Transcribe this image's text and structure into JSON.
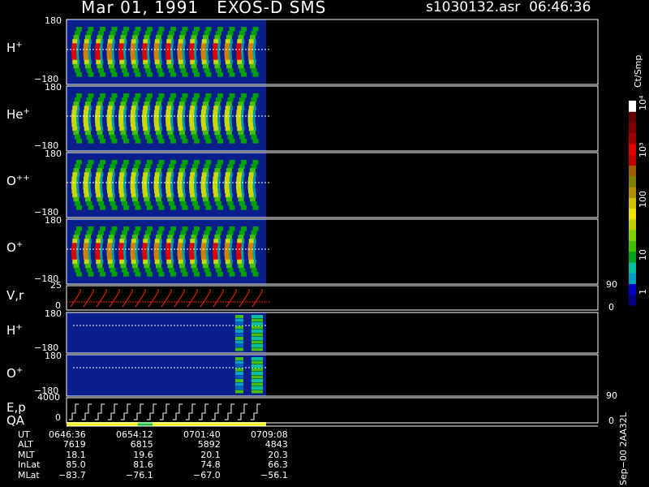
{
  "header": {
    "title": "Mar 01, 1991   EXOS-D SMS",
    "file": "s1030132.asr",
    "time": "06:46:36"
  },
  "panels": [
    {
      "id": "h-plus",
      "species": "H",
      "charge": "+",
      "ymax": "180",
      "ymin": "−180"
    },
    {
      "id": "he-plus",
      "species": "He",
      "charge": "+",
      "ymax": "180",
      "ymin": "−180"
    },
    {
      "id": "o-plus-plus",
      "species": "O",
      "charge": "++",
      "ymax": "180",
      "ymin": "−180"
    },
    {
      "id": "o-plus",
      "species": "O",
      "charge": "+",
      "ymax": "180",
      "ymin": "−180"
    }
  ],
  "vr_panel": {
    "label": "V,r",
    "ymax": "25",
    "ymin": "0",
    "right_top": "90",
    "right_bottom": "0"
  },
  "small_panels": [
    {
      "id": "h-plus-small",
      "species": "H",
      "charge": "+",
      "ymax": "180",
      "ymin": "−180"
    },
    {
      "id": "o-plus-small",
      "species": "O",
      "charge": "+",
      "ymax": "180",
      "ymin": "−180"
    }
  ],
  "ep_panel": {
    "label1": "E,p",
    "label2": "QA",
    "ymax": "4000",
    "ymin": "0",
    "right_top": "90",
    "right_bottom": "0"
  },
  "colorbar": {
    "units": "Ct/Smp",
    "ticks": [
      "1",
      "10",
      "100",
      "10³",
      "10⁴"
    ],
    "colors": [
      "#000080",
      "#0000c0",
      "#00a0c0",
      "#00c0a0",
      "#00a020",
      "#40c000",
      "#80d000",
      "#c0d000",
      "#f0e000",
      "#d0c000",
      "#b09000",
      "#808000",
      "#a06000",
      "#c00000",
      "#e00000",
      "#a00000",
      "#800000",
      "#600000",
      "#ffffff"
    ]
  },
  "footer": {
    "rows": [
      {
        "label": "UT",
        "values": [
          "0646:36",
          "0654:12",
          "0701:40",
          "0709:08"
        ]
      },
      {
        "label": "ALT",
        "values": [
          "7619",
          "6815",
          "5892",
          "4843"
        ]
      },
      {
        "label": "MLT",
        "values": [
          "18.1",
          "19.6",
          "20.1",
          "20.3"
        ]
      },
      {
        "label": "InLat",
        "values": [
          "85.0",
          "81.6",
          "74.8",
          "66.3"
        ]
      },
      {
        "label": "MLat",
        "values": [
          "−83.7",
          "−76.1",
          "−67.0",
          "−56.1"
        ]
      }
    ]
  },
  "vertical_date": "Sep−00 2AA32L",
  "chart_data": {
    "type": "heatmap",
    "title": "Mar 01, 1991   EXOS-D SMS",
    "x": [
      "0646:36",
      "0654:12",
      "0701:40",
      "0709:08"
    ],
    "y_range": [
      -180,
      180
    ],
    "series": [
      {
        "name": "H+"
      },
      {
        "name": "He+"
      },
      {
        "name": "O++"
      },
      {
        "name": "O+"
      }
    ]
  }
}
